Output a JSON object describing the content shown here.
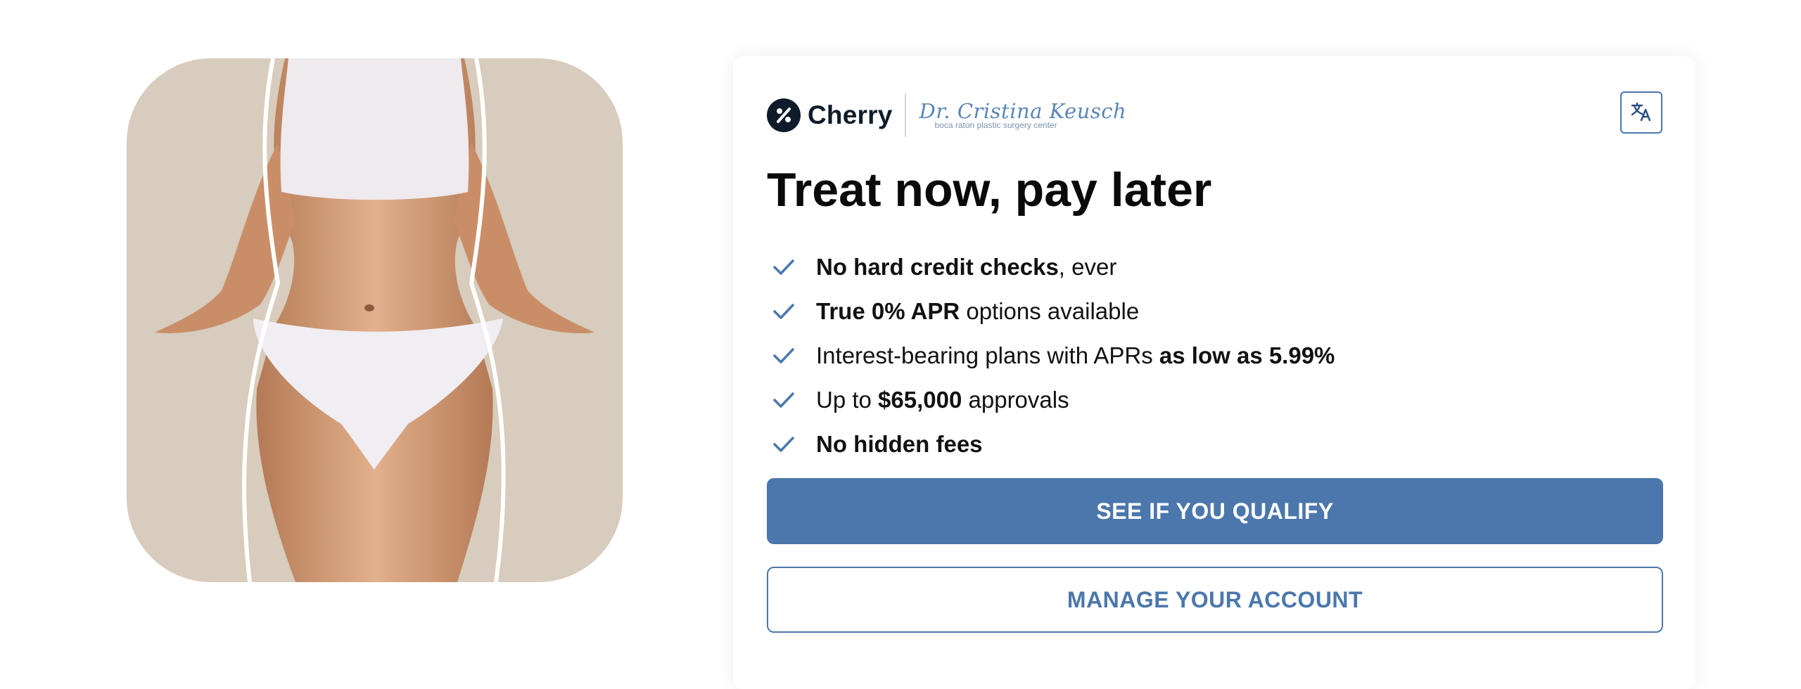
{
  "hero": {
    "image_alt": "Woman in white underwear with body contour outline",
    "background_color": "#d7ccbd"
  },
  "brand": {
    "logo_icon": "percent-icon",
    "name": "Cherry",
    "partner_name": "Dr. Cristina Keusch",
    "partner_tagline": "boca raton plastic surgery center"
  },
  "translate_button": {
    "icon": "translate-icon"
  },
  "headline": "Treat now, pay later",
  "features": [
    {
      "parts": [
        {
          "text": "No hard credit checks",
          "bold": true
        },
        {
          "text": ", ever",
          "bold": false
        }
      ]
    },
    {
      "parts": [
        {
          "text": "True 0% APR",
          "bold": true
        },
        {
          "text": " options available",
          "bold": false
        }
      ]
    },
    {
      "parts": [
        {
          "text": "Interest-bearing plans with APRs ",
          "bold": false
        },
        {
          "text": "as low as 5.99%",
          "bold": true
        }
      ]
    },
    {
      "parts": [
        {
          "text": "Up to ",
          "bold": false
        },
        {
          "text": "$65,000",
          "bold": true
        },
        {
          "text": " approvals",
          "bold": false
        }
      ]
    },
    {
      "parts": [
        {
          "text": "No hidden fees",
          "bold": true
        }
      ]
    }
  ],
  "buttons": {
    "qualify_label": "SEE IF YOU QUALIFY",
    "manage_label": "MANAGE YOUR ACCOUNT"
  },
  "colors": {
    "accent": "#4b77ac",
    "brand_dark": "#0d1b2a",
    "check": "#4b77ac"
  }
}
